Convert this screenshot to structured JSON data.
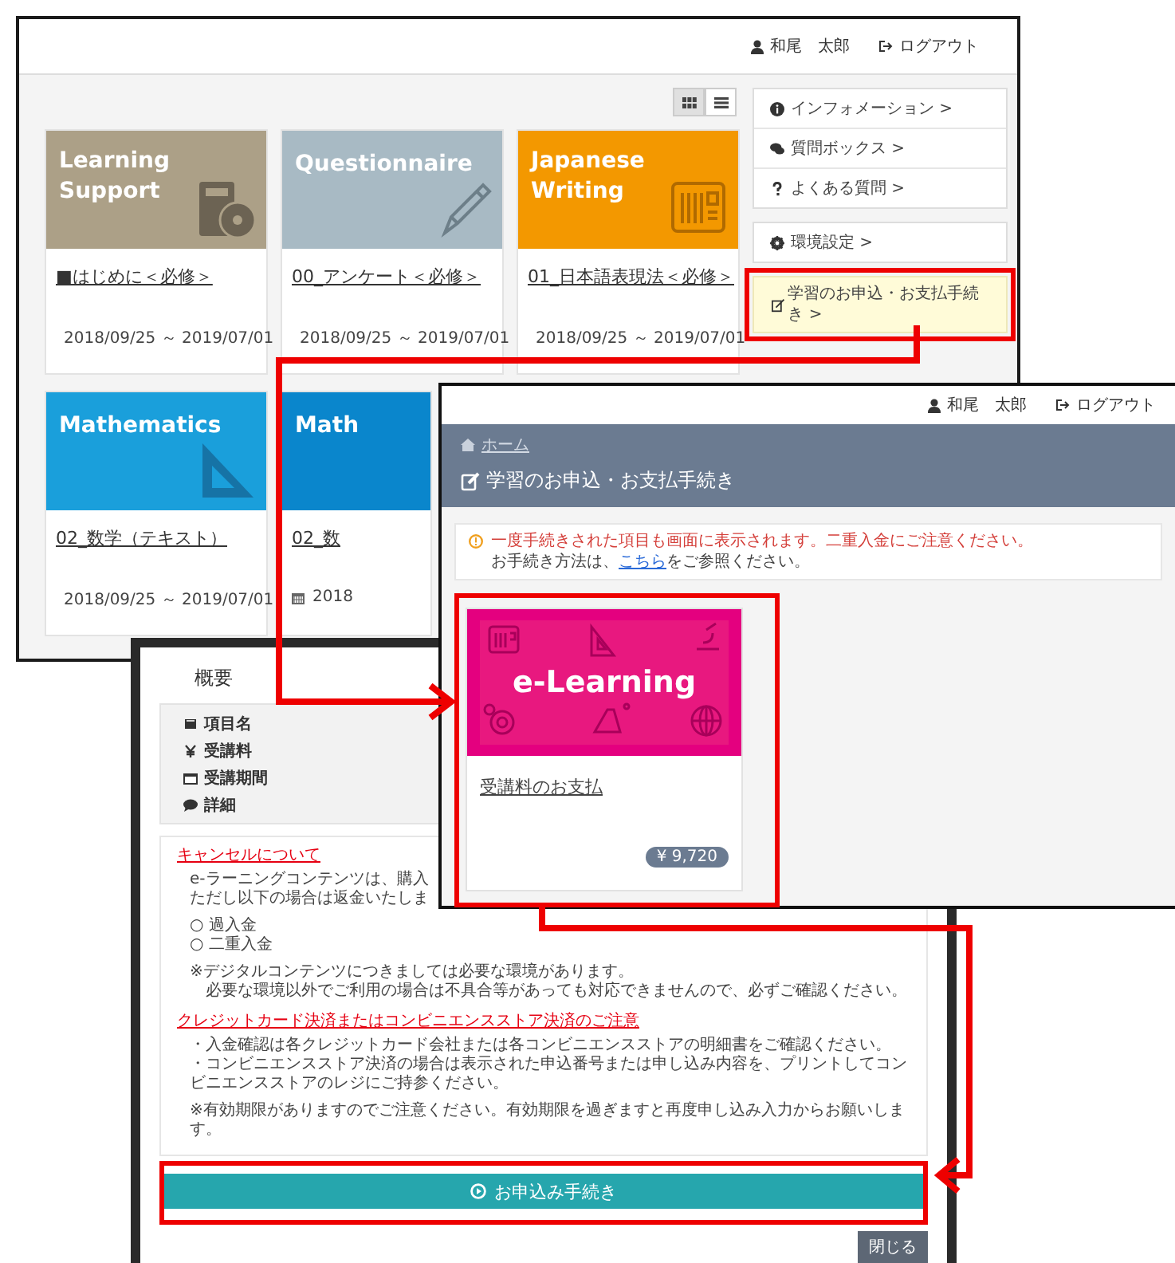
{
  "main_window": {
    "user": "和尾　太郎",
    "logout": "ログアウト",
    "view_toggle": [
      {
        "selected": true
      },
      {
        "selected": false
      }
    ],
    "courses": [
      {
        "label": "Learning Support",
        "color": "#aca087",
        "title": "■はじめに＜必修＞",
        "period": "2018/09/25 ～ 2019/07/01"
      },
      {
        "label": "Questionnaire",
        "color": "#a8bac4",
        "title": "00_アンケート＜必修＞",
        "period": "2018/09/25 ～ 2019/07/01"
      },
      {
        "label": "Japanese Writing",
        "color": "#f39800",
        "title": "01_日本語表現法＜必修＞",
        "period": "2018/09/25 ～ 2019/07/01"
      },
      {
        "label": "Mathematics",
        "color": "#1a9fdb",
        "title": "02_数学（テキスト）",
        "period": "2018/09/25 ～ 2019/07/01"
      },
      {
        "label": "Math",
        "color": "#0a86cc",
        "title": "02_数",
        "period": "2018"
      }
    ],
    "sidebar_groups": [
      {
        "kind": "links",
        "items": [
          {
            "label": "インフォメーション >"
          },
          {
            "label": "質問ボックス >"
          },
          {
            "label": "よくある質問 >"
          }
        ]
      },
      {
        "kind": "links",
        "items": [
          {
            "label": "環境設定 >"
          }
        ]
      },
      {
        "kind": "notice",
        "items": [
          {
            "label": "学習のお申込・お支払手続き >"
          }
        ]
      }
    ]
  },
  "application_window": {
    "user": "和尾　太郎",
    "logout": "ログアウト",
    "breadcrumb": "ホーム",
    "title": "学習のお申込・お支払手続き",
    "warning": "一度手続きされた項目も画面に表示されます。二重入金にご注意ください。",
    "help_before": "お手続き方法は、",
    "help_link": "こちら",
    "help_after": "をご参照ください。",
    "card": {
      "label": "e-Learning",
      "title": "受講料のお支払",
      "price": "¥ 9,720"
    }
  },
  "details_dialog": {
    "heading": "概要",
    "fields": [
      "項目名",
      "受講料",
      "受講期間",
      "詳細"
    ],
    "cancel_title": "キャンセルについて",
    "cancel_lines": [
      "e-ラーニングコンテンツは、購入",
      "ただし以下の場合は返金いたしま"
    ],
    "options": [
      "○ 過入金",
      "○ 二重入金"
    ],
    "notes": [
      "※デジタルコンテンツにつきましては必要な環境があります。",
      "必要な環境以外でご利用の場合は不具合等があっても対応できませんので、必ずご確認ください。"
    ],
    "payment_title": "クレジットカード決済またはコンビニエンスストア決済のご注意",
    "payment_bullets": [
      "・入金確認は各クレジットカード会社または各コンビニエンスストアの明細書をご確認ください。",
      "・コンビニエンスストア決済の場合は表示された申込番号または申し込み内容を、プリントしてコンビニエンスストアのレジにご持参ください。"
    ],
    "expiry_note": "※有効期限がありますのでご注意ください。有効期限を過ぎますと再度申し込み入力からお願いします。",
    "apply_button": "お申込み手続き",
    "close_button": "閉じる"
  }
}
